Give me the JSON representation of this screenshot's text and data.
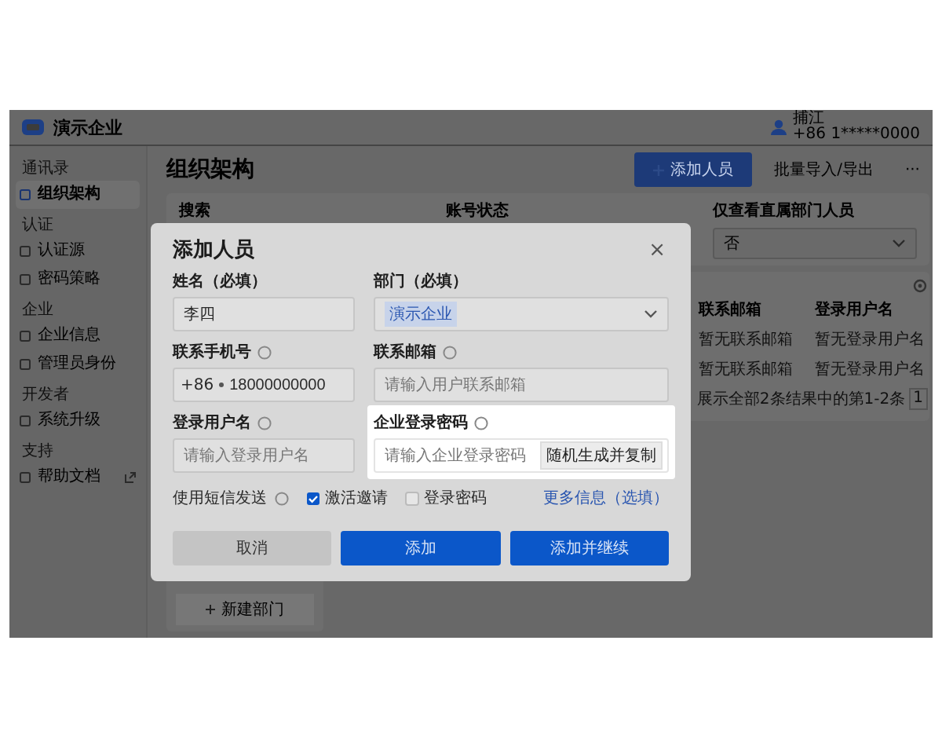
{
  "topbar": {
    "company": "演示企业",
    "user": {
      "name": "捕江",
      "phone": "+86 1*****0000"
    }
  },
  "sidebar": {
    "sections": [
      {
        "label": "通讯录",
        "items": [
          {
            "label": "组织架构",
            "selected": true,
            "external": false
          }
        ]
      },
      {
        "label": "认证",
        "items": [
          {
            "label": "认证源",
            "selected": false,
            "external": false
          },
          {
            "label": "密码策略",
            "selected": false,
            "external": false
          }
        ]
      },
      {
        "label": "企业",
        "items": [
          {
            "label": "企业信息",
            "selected": false,
            "external": false
          },
          {
            "label": "管理员身份",
            "selected": false,
            "external": false
          }
        ]
      },
      {
        "label": "开发者",
        "items": [
          {
            "label": "系统升级",
            "selected": false,
            "external": false
          }
        ]
      },
      {
        "label": "支持",
        "items": [
          {
            "label": "帮助文档",
            "selected": false,
            "external": true
          }
        ]
      }
    ]
  },
  "page": {
    "title": "组织架构",
    "add_button": "添加人员",
    "import_button": "批量导入/导出",
    "more_button": "···"
  },
  "filters": [
    {
      "label": "搜索",
      "kind": "search"
    },
    {
      "label": "账号状态",
      "kind": "select"
    },
    {
      "label": "仅查看直属部门人员",
      "kind": "select",
      "value": "否"
    }
  ],
  "departments": {
    "new_button": "新建部门"
  },
  "table": {
    "columns": [
      "联系邮箱",
      "登录用户名"
    ],
    "rows": [
      [
        "暂无联系邮箱",
        "暂无登录用户名"
      ],
      [
        "暂无联系邮箱",
        "暂无登录用户名"
      ]
    ],
    "summary": "展示全部2条结果中的第1-2条",
    "page": "1"
  },
  "modal": {
    "title": "添加人员",
    "close": "×",
    "fields": [
      {
        "kind": "text",
        "label": "姓名（必填）",
        "help": false,
        "highlighted": false,
        "value": "李四"
      },
      {
        "kind": "select",
        "label": "部门（必填）",
        "help": false,
        "highlighted": false,
        "value": "演示企业"
      },
      {
        "kind": "phone",
        "label": "联系手机号",
        "help": true,
        "highlighted": false,
        "prefix": "+86",
        "value": "18000000000"
      },
      {
        "kind": "text",
        "label": "联系邮箱",
        "help": true,
        "highlighted": false,
        "placeholder": "请输入用户联系邮箱"
      },
      {
        "kind": "text",
        "label": "登录用户名",
        "help": true,
        "highlighted": false,
        "placeholder": "请输入登录用户名"
      },
      {
        "kind": "password",
        "label": "企业登录密码",
        "help": true,
        "highlighted": true,
        "placeholder": "请输入企业登录密码",
        "action": "随机生成并复制"
      }
    ],
    "sms": {
      "label": "使用短信发送",
      "checks": [
        {
          "label": "激活邀请",
          "checked": true
        },
        {
          "label": "登录密码",
          "checked": false
        }
      ],
      "link": "更多信息（选填）"
    },
    "buttons": [
      {
        "label": "取消",
        "kind": "secondary"
      },
      {
        "label": "添加",
        "kind": "primary"
      },
      {
        "label": "添加并继续",
        "kind": "primary"
      }
    ]
  }
}
